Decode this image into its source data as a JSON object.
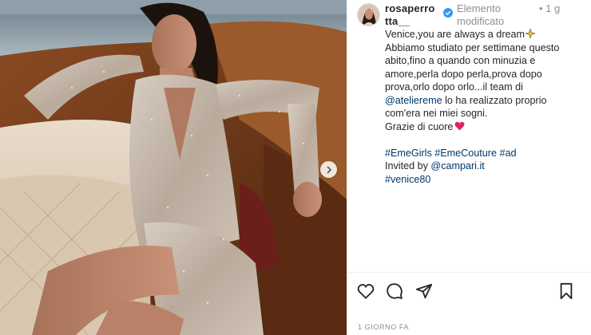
{
  "post": {
    "username": "rosaperrotta__",
    "status": "Elemento modificato",
    "more_label": "• 1 g",
    "date": "1 GIORNO FA"
  },
  "caption": {
    "line1": "Venice,you are always a dream",
    "paragraph": "Abbiamo studiato per settimane questo abito,fino a quando con minuzia e amore,perla dopo perla,prova dopo prova,orlo dopo orlo...il team di ",
    "mention1": "@ateliereme",
    "paragraph_end": " lo ha realizzato proprio com'era nei miei sogni.",
    "thanks": "Grazie di cuore",
    "hashtags": "#EmeGirls #EmeCouture #ad",
    "invited_prefix": "Invited by ",
    "mention2": "@campari.it",
    "hashtag2": "#venice80"
  },
  "icons": {
    "like": "heart-icon",
    "comment": "comment-icon",
    "share": "paper-plane-icon",
    "save": "bookmark-icon",
    "next": "chevron-right-icon",
    "verified": "verified-badge-icon",
    "emoji1": "sparkle-emoji-icon",
    "emoji2": "red-heart-emoji-icon"
  },
  "colors": {
    "link": "#00376b",
    "verified": "#3897f0",
    "heart": "#e0245e"
  }
}
